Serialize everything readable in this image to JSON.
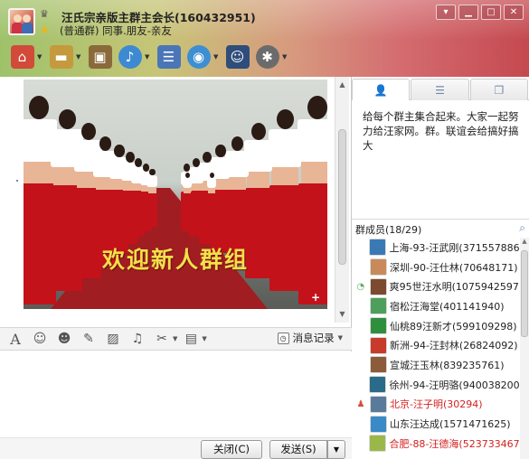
{
  "window": {
    "title": "汪氏宗亲版主群主会长(160432951)",
    "subtitle": "(普通群) 同事.朋友-亲友"
  },
  "toolbar": {
    "items": [
      {
        "name": "home",
        "icon": "home-icon",
        "color": "#d24a3a"
      },
      {
        "name": "folder",
        "icon": "folder-icon",
        "color": "#c59a3c"
      },
      {
        "name": "album",
        "icon": "photo-album-icon",
        "color": "#8a6a3a"
      },
      {
        "name": "voice",
        "icon": "microphone-icon",
        "color": "#3d8ad2"
      },
      {
        "name": "notes",
        "icon": "notes-add-icon",
        "color": "#4a76b8"
      },
      {
        "name": "webcam",
        "icon": "webcam-icon",
        "color": "#3d8fd2"
      },
      {
        "name": "police",
        "icon": "police-officer-icon",
        "color": "#2f4d7a"
      },
      {
        "name": "settings",
        "icon": "gear-icon",
        "color": "#6b6b6b"
      }
    ]
  },
  "chat": {
    "image_caption": "欢迎新人群组"
  },
  "format_bar": {
    "message_log_label": "消息记录"
  },
  "buttons": {
    "close_label": "关闭(C)",
    "send_label": "发送(S)"
  },
  "side": {
    "notice": "给每个群主集合起来。大家一起努力给汪家网。群。联谊会给搞好搞大",
    "members_header": "群成员(18/29)",
    "members": [
      {
        "name": "上海-93-汪武刚(371557886)",
        "red": false,
        "mark": "",
        "avatar": "#3a7ab4"
      },
      {
        "name": "深圳-90-汪仕林(70648171)",
        "red": false,
        "mark": "",
        "avatar": "#c98a5b"
      },
      {
        "name": "爽95世汪水明(1075942597)",
        "red": false,
        "mark": "talk",
        "avatar": "#7c4a2e"
      },
      {
        "name": "宿松汪海堂(401141940)",
        "red": false,
        "mark": "",
        "avatar": "#4d9f5b"
      },
      {
        "name": "仙桃89汪新才(599109298)",
        "red": false,
        "mark": "",
        "avatar": "#2f8f3d"
      },
      {
        "name": "新洲-94-汪封林(26824092)",
        "red": false,
        "mark": "",
        "avatar": "#c83a2a"
      },
      {
        "name": "宣城汪玉林(839235761)",
        "red": false,
        "mark": "",
        "avatar": "#8b5b3a"
      },
      {
        "name": "徐州-94-汪明骆(940038200)",
        "red": false,
        "mark": "",
        "avatar": "#2a6b8a"
      },
      {
        "name": "北京-汪子明(30294)",
        "red": true,
        "mark": "owner",
        "avatar": "#5a7a9b"
      },
      {
        "name": "山东汪达成(1571471625)",
        "red": false,
        "mark": "",
        "avatar": "#3a8ac8"
      },
      {
        "name": "合肥-88-汪德海(523733467)",
        "red": true,
        "mark": "",
        "avatar": "#9ab84a"
      }
    ]
  },
  "colors": {
    "header_left": "#9ec26a",
    "header_right": "#c4494f",
    "carpet": "#a01d22",
    "caption": "#f3e049",
    "owner_name": "#d42020"
  }
}
